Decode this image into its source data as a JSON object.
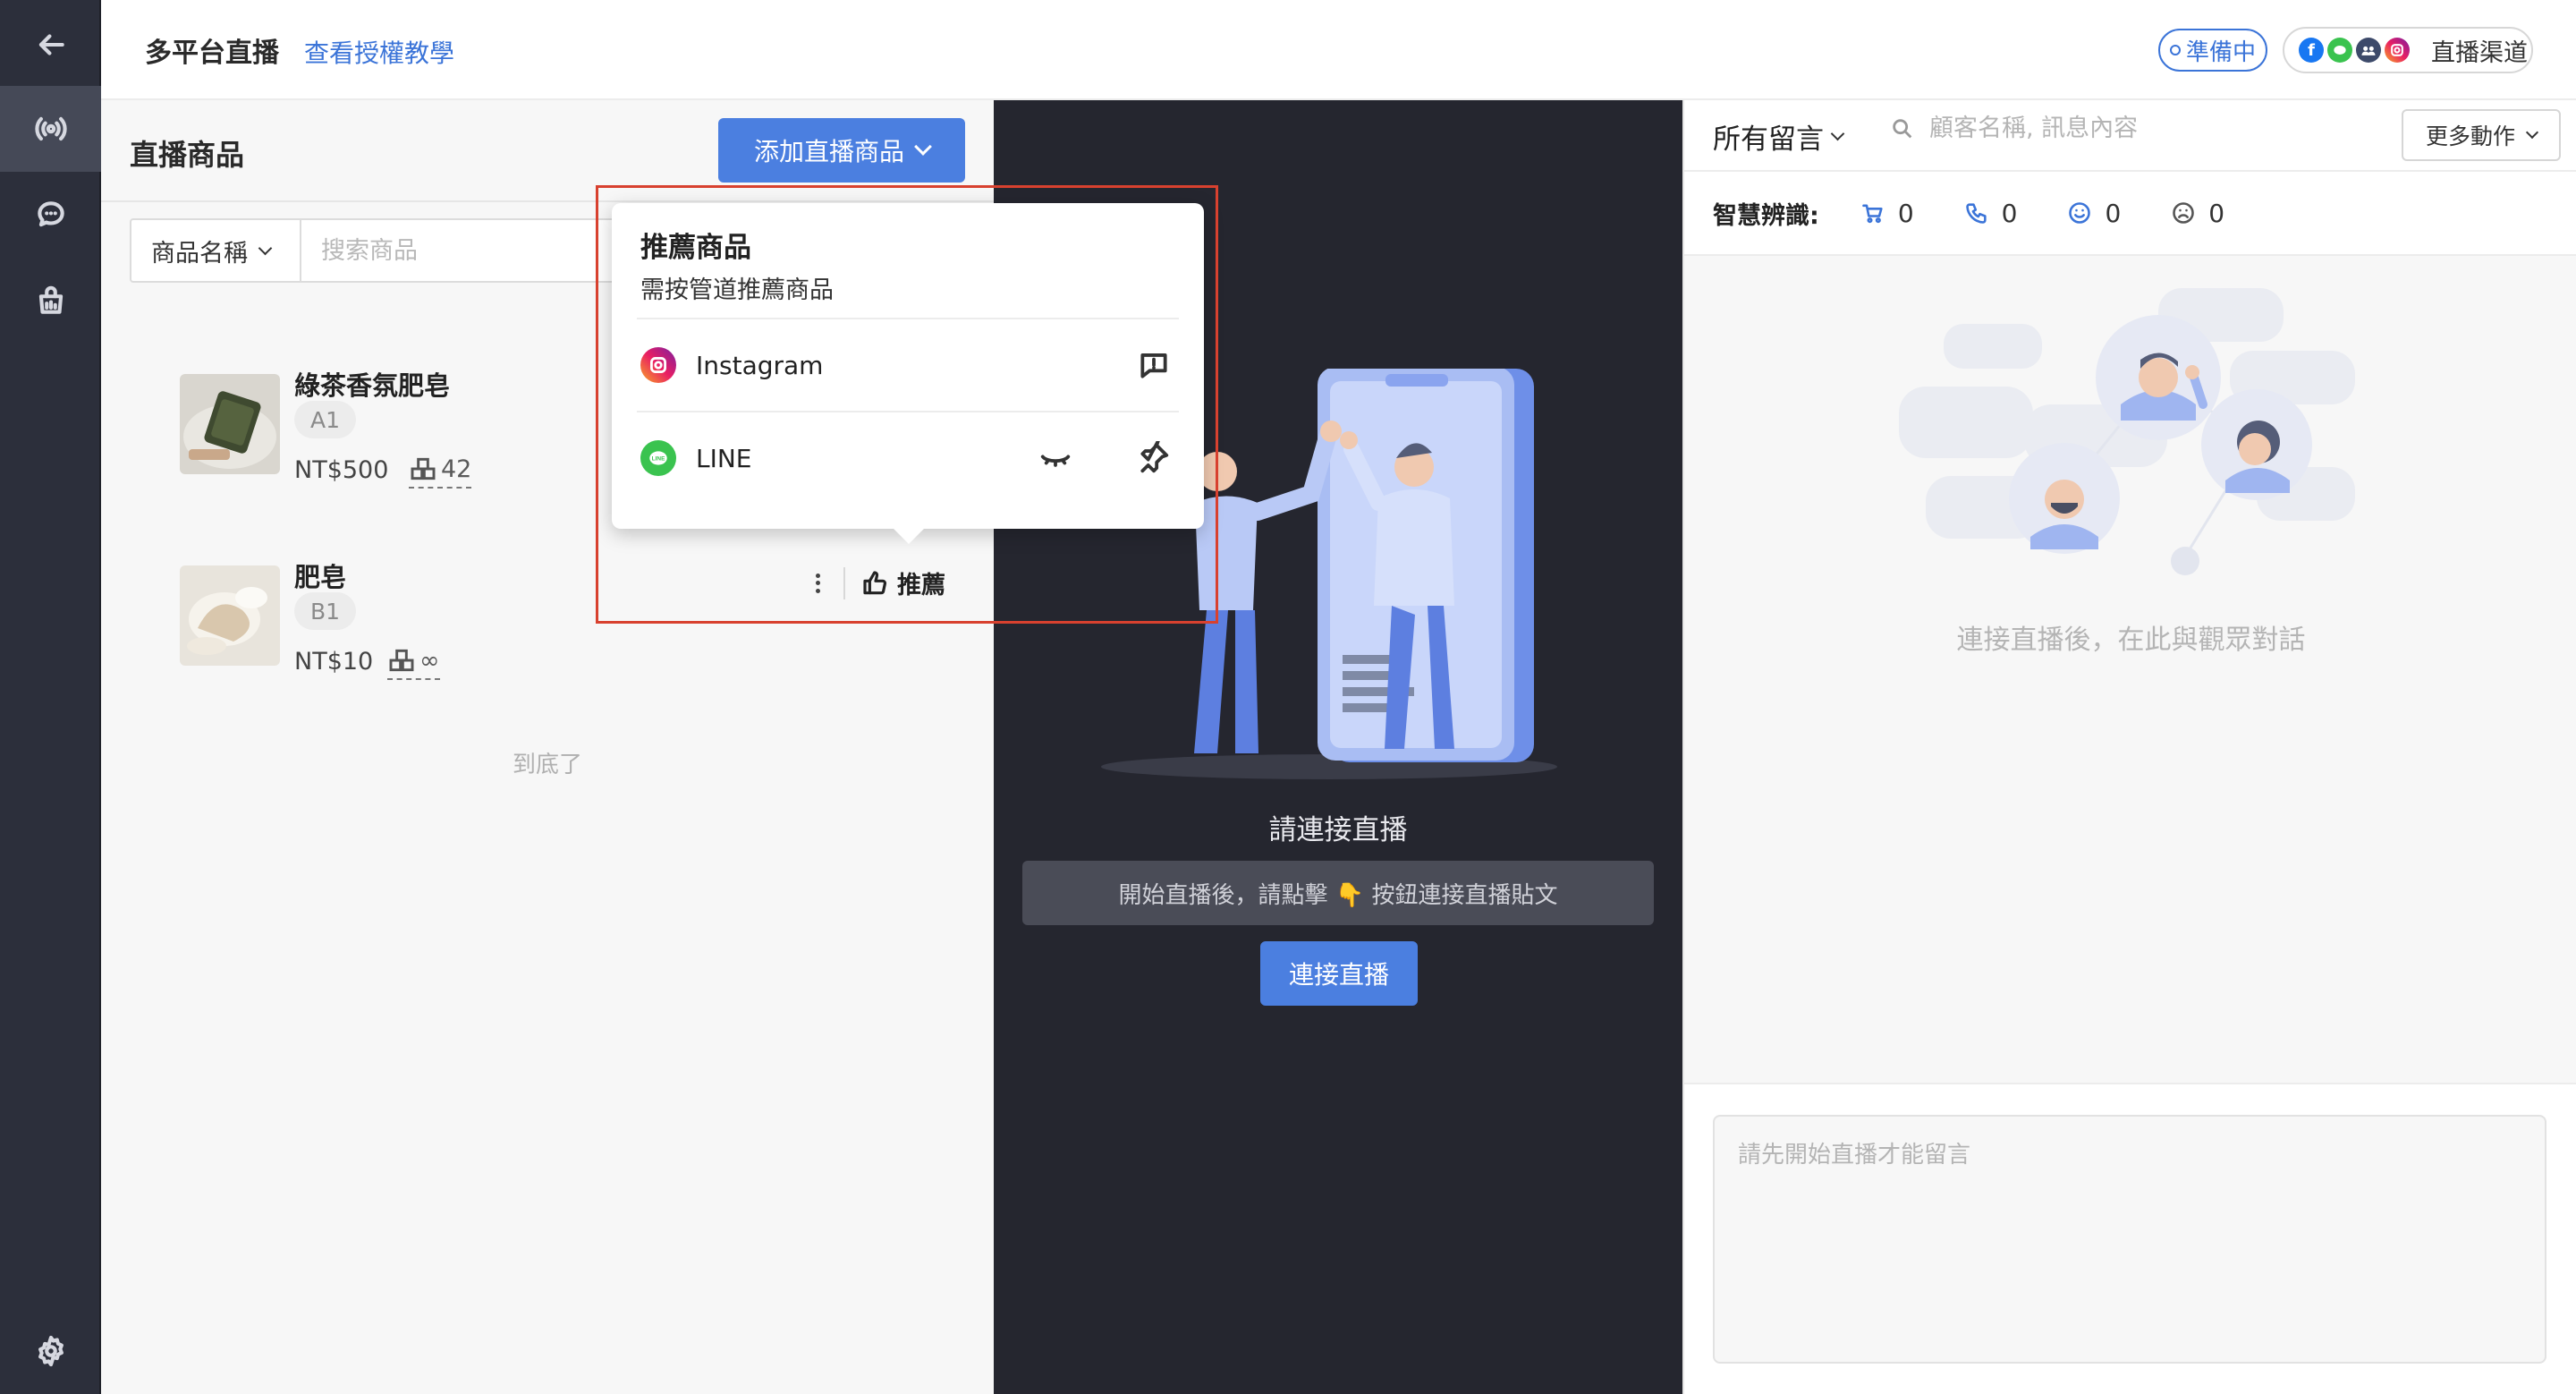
{
  "header": {
    "title": "多平台直播",
    "tutorial_link": "查看授權教學",
    "status": "準備中",
    "channels_label": "直播渠道",
    "channel_icons": [
      "facebook-icon",
      "line-icon",
      "group-icon",
      "instagram-icon"
    ]
  },
  "products": {
    "title": "直播商品",
    "add_button": "添加直播商品",
    "filter_select": "商品名稱",
    "search_placeholder": "搜索商品",
    "items": [
      {
        "name": "綠茶香氛肥皂",
        "tag": "A1",
        "price": "NT$500",
        "stock": "42"
      },
      {
        "name": "肥皂",
        "tag": "B1",
        "price": "NT$10",
        "stock": "∞"
      }
    ],
    "recommend_label": "推薦",
    "end_text": "到底了"
  },
  "popover": {
    "title": "推薦商品",
    "subtitle": "需按管道推薦商品",
    "channels": [
      {
        "name": "Instagram"
      },
      {
        "name": "LINE"
      }
    ]
  },
  "live": {
    "label": "請連接直播",
    "hint": "開始直播後，請點擊 👇 按鈕連接直播貼文",
    "connect_button": "連接直播"
  },
  "comments": {
    "filter": "所有留言",
    "search_placeholder": "顧客名稱, 訊息內容",
    "more_button": "更多動作",
    "smart_label": "智慧辨識:",
    "counts": {
      "cart": "0",
      "phone": "0",
      "happy": "0",
      "sad": "0"
    },
    "empty_text": "連接直播後，在此與觀眾對話",
    "composer_placeholder": "請先開始直播才能留言"
  },
  "colors": {
    "accent": "#4b7fe0",
    "rail": "#2c2f3b",
    "dark_stage": "#25262f",
    "highlight": "#d8412f"
  }
}
